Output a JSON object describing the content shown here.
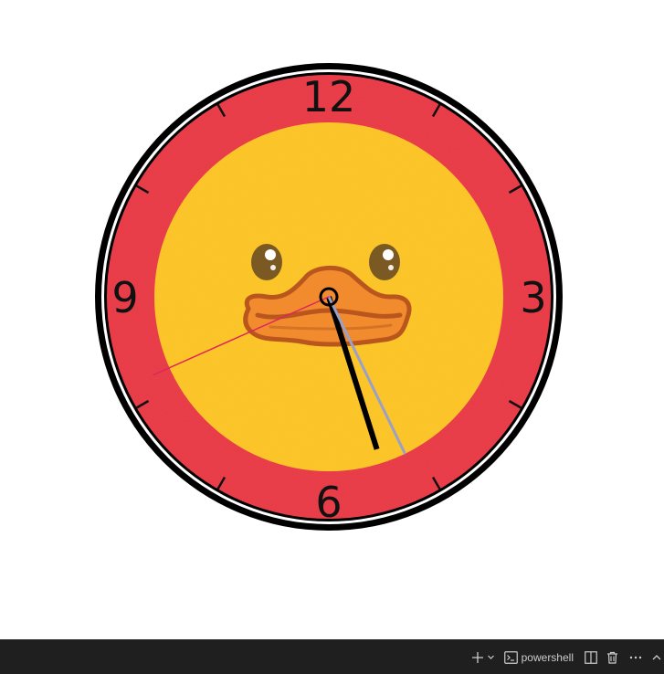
{
  "clock": {
    "numerals": {
      "twelve": "12",
      "three": "3",
      "six": "6",
      "nine": "9"
    },
    "time": {
      "hour": 5,
      "minute": 25,
      "second": 41
    },
    "colors": {
      "outer_ring": "#000000",
      "red_band": "#ea3f4a",
      "yellow_face": "#fdc729",
      "hour_hand": "#000000",
      "minute_hand": "#9aa0c8",
      "second_hand": "#e0245e",
      "beak": "#f28a2e",
      "beak_outline": "#b9561d",
      "eyes": "#7a5a22"
    }
  },
  "terminal_bar": {
    "new_terminal_icon": "plus-icon",
    "dropdown_icon": "chevron-down-icon",
    "shell_icon": "terminal-icon",
    "shell_label": "powershell",
    "split_icon": "split-pane-icon",
    "delete_icon": "trash-icon",
    "more_icon": "more-icon",
    "maximize_icon": "chevron-up-icon"
  }
}
